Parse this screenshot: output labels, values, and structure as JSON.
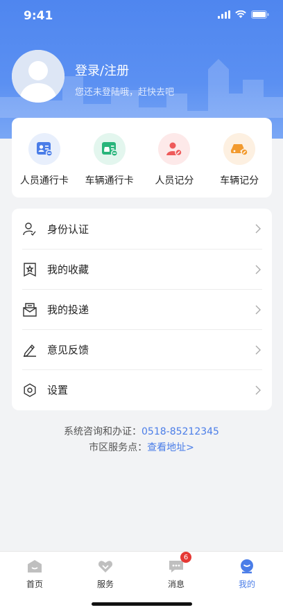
{
  "status": {
    "time": "9:41"
  },
  "profile": {
    "login_text": "登录/注册",
    "subtitle": "您还未登陆哦，赶快去吧"
  },
  "quick_actions": [
    {
      "label": "人员通行卡",
      "icon": "person-card-icon",
      "color": "#4a7de8",
      "bg": "#e8effc"
    },
    {
      "label": "车辆通行卡",
      "icon": "vehicle-card-icon",
      "color": "#29b57b",
      "bg": "#e3f6ee"
    },
    {
      "label": "人员记分",
      "icon": "person-score-icon",
      "color": "#ee5a5a",
      "bg": "#fde9e9"
    },
    {
      "label": "车辆记分",
      "icon": "vehicle-score-icon",
      "color": "#f29a2e",
      "bg": "#fdf0e1"
    }
  ],
  "menu": [
    {
      "label": "身份认证",
      "icon": "identity-verify-icon"
    },
    {
      "label": "我的收藏",
      "icon": "favorites-icon"
    },
    {
      "label": "我的投递",
      "icon": "delivery-icon"
    },
    {
      "label": "意见反馈",
      "icon": "feedback-icon"
    },
    {
      "label": "设置",
      "icon": "settings-icon"
    }
  ],
  "contact": {
    "consult_label": "系统咨询和办证：",
    "phone": "0518-85212345",
    "service_label": "市区服务点：",
    "address_link": "查看地址>"
  },
  "tabs": [
    {
      "label": "首页",
      "icon": "home-icon",
      "active": false
    },
    {
      "label": "服务",
      "icon": "service-icon",
      "active": false
    },
    {
      "label": "消息",
      "icon": "message-icon",
      "active": false,
      "badge": "6"
    },
    {
      "label": "我的",
      "icon": "profile-icon",
      "active": true
    }
  ],
  "colors": {
    "accent": "#4a7de8",
    "header": "#4f86ef",
    "badge": "#e53935"
  }
}
